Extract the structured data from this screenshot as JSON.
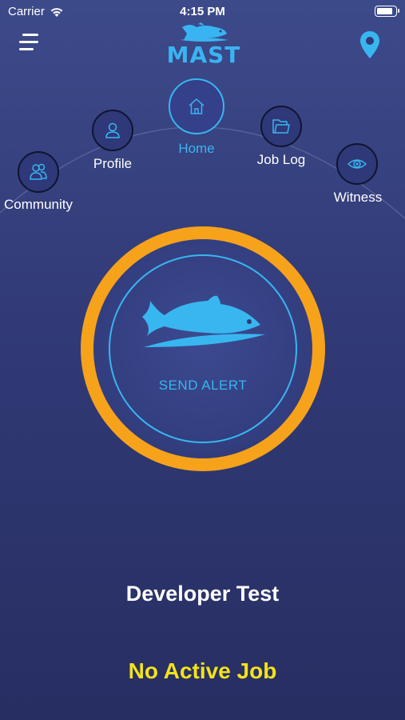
{
  "status_bar": {
    "carrier": "Carrier",
    "time": "4:15 PM",
    "battery_level": 0.9
  },
  "header": {
    "menu_icon": "hamburger-icon",
    "logo_text": "MAST",
    "location_icon": "location-pin-icon"
  },
  "nav": {
    "items": [
      {
        "label": "Community",
        "icon": "community-icon",
        "active": false
      },
      {
        "label": "Profile",
        "icon": "profile-icon",
        "active": false
      },
      {
        "label": "Home",
        "icon": "home-icon",
        "active": true
      },
      {
        "label": "Job Log",
        "icon": "folder-icon",
        "active": false
      },
      {
        "label": "Witness",
        "icon": "eye-icon",
        "active": false
      }
    ]
  },
  "alert": {
    "label": "SEND ALERT",
    "icon": "fish-icon"
  },
  "user": {
    "name": "Developer Test"
  },
  "job": {
    "status": "No Active Job"
  },
  "colors": {
    "accent": "#38b6f0",
    "alert_ring": "#f7a21b",
    "job_status": "#f4e21a",
    "background": "#313a76"
  }
}
